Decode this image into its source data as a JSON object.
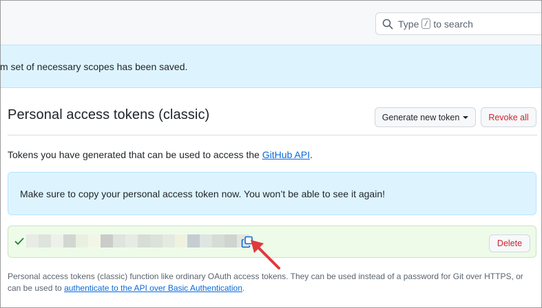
{
  "search": {
    "prefix": "Type",
    "key": "/",
    "suffix": "to search"
  },
  "flash": {
    "message": "m set of necessary scopes has been saved."
  },
  "page": {
    "title": "Personal access tokens (classic)",
    "generate_label": "Generate new token",
    "revoke_all_label": "Revoke all",
    "description_prefix": "Tokens you have generated that can be used to access the ",
    "description_link": "GitHub API",
    "description_suffix": "."
  },
  "info_box": {
    "message": "Make sure to copy your personal access token now. You won’t be able to see it again!"
  },
  "token": {
    "value_state": "blurred",
    "delete_label": "Delete",
    "copy_icon": "copy-icon",
    "check_icon": "check-icon"
  },
  "footnote": {
    "text_before": "Personal access tokens (classic) function like ordinary OAuth access tokens. They can be used instead of a password for Git over HTTPS, or can be used to ",
    "link": "authenticate to the API over Basic Authentication",
    "text_after": "."
  },
  "colors": {
    "accent": "#0969da",
    "danger": "#cf222e",
    "flash_bg": "#ddf4ff",
    "success_bg": "#eefbe9",
    "annotation_arrow": "#e0393e"
  }
}
